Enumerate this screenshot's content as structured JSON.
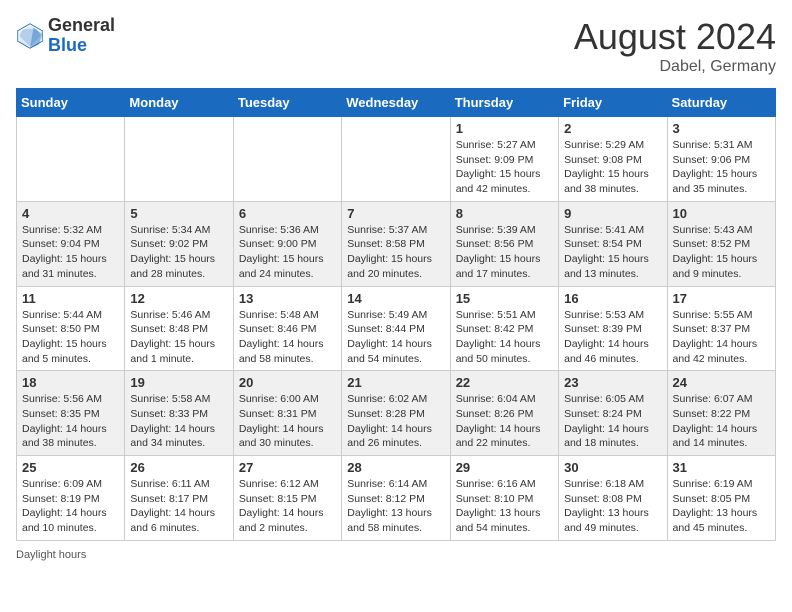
{
  "header": {
    "logo_general": "General",
    "logo_blue": "Blue",
    "month_title": "August 2024",
    "location": "Dabel, Germany"
  },
  "calendar": {
    "weekdays": [
      "Sunday",
      "Monday",
      "Tuesday",
      "Wednesday",
      "Thursday",
      "Friday",
      "Saturday"
    ],
    "weeks": [
      [
        {
          "day": "",
          "info": ""
        },
        {
          "day": "",
          "info": ""
        },
        {
          "day": "",
          "info": ""
        },
        {
          "day": "",
          "info": ""
        },
        {
          "day": "1",
          "info": "Sunrise: 5:27 AM\nSunset: 9:09 PM\nDaylight: 15 hours and 42 minutes."
        },
        {
          "day": "2",
          "info": "Sunrise: 5:29 AM\nSunset: 9:08 PM\nDaylight: 15 hours and 38 minutes."
        },
        {
          "day": "3",
          "info": "Sunrise: 5:31 AM\nSunset: 9:06 PM\nDaylight: 15 hours and 35 minutes."
        }
      ],
      [
        {
          "day": "4",
          "info": "Sunrise: 5:32 AM\nSunset: 9:04 PM\nDaylight: 15 hours and 31 minutes."
        },
        {
          "day": "5",
          "info": "Sunrise: 5:34 AM\nSunset: 9:02 PM\nDaylight: 15 hours and 28 minutes."
        },
        {
          "day": "6",
          "info": "Sunrise: 5:36 AM\nSunset: 9:00 PM\nDaylight: 15 hours and 24 minutes."
        },
        {
          "day": "7",
          "info": "Sunrise: 5:37 AM\nSunset: 8:58 PM\nDaylight: 15 hours and 20 minutes."
        },
        {
          "day": "8",
          "info": "Sunrise: 5:39 AM\nSunset: 8:56 PM\nDaylight: 15 hours and 17 minutes."
        },
        {
          "day": "9",
          "info": "Sunrise: 5:41 AM\nSunset: 8:54 PM\nDaylight: 15 hours and 13 minutes."
        },
        {
          "day": "10",
          "info": "Sunrise: 5:43 AM\nSunset: 8:52 PM\nDaylight: 15 hours and 9 minutes."
        }
      ],
      [
        {
          "day": "11",
          "info": "Sunrise: 5:44 AM\nSunset: 8:50 PM\nDaylight: 15 hours and 5 minutes."
        },
        {
          "day": "12",
          "info": "Sunrise: 5:46 AM\nSunset: 8:48 PM\nDaylight: 15 hours and 1 minute."
        },
        {
          "day": "13",
          "info": "Sunrise: 5:48 AM\nSunset: 8:46 PM\nDaylight: 14 hours and 58 minutes."
        },
        {
          "day": "14",
          "info": "Sunrise: 5:49 AM\nSunset: 8:44 PM\nDaylight: 14 hours and 54 minutes."
        },
        {
          "day": "15",
          "info": "Sunrise: 5:51 AM\nSunset: 8:42 PM\nDaylight: 14 hours and 50 minutes."
        },
        {
          "day": "16",
          "info": "Sunrise: 5:53 AM\nSunset: 8:39 PM\nDaylight: 14 hours and 46 minutes."
        },
        {
          "day": "17",
          "info": "Sunrise: 5:55 AM\nSunset: 8:37 PM\nDaylight: 14 hours and 42 minutes."
        }
      ],
      [
        {
          "day": "18",
          "info": "Sunrise: 5:56 AM\nSunset: 8:35 PM\nDaylight: 14 hours and 38 minutes."
        },
        {
          "day": "19",
          "info": "Sunrise: 5:58 AM\nSunset: 8:33 PM\nDaylight: 14 hours and 34 minutes."
        },
        {
          "day": "20",
          "info": "Sunrise: 6:00 AM\nSunset: 8:31 PM\nDaylight: 14 hours and 30 minutes."
        },
        {
          "day": "21",
          "info": "Sunrise: 6:02 AM\nSunset: 8:28 PM\nDaylight: 14 hours and 26 minutes."
        },
        {
          "day": "22",
          "info": "Sunrise: 6:04 AM\nSunset: 8:26 PM\nDaylight: 14 hours and 22 minutes."
        },
        {
          "day": "23",
          "info": "Sunrise: 6:05 AM\nSunset: 8:24 PM\nDaylight: 14 hours and 18 minutes."
        },
        {
          "day": "24",
          "info": "Sunrise: 6:07 AM\nSunset: 8:22 PM\nDaylight: 14 hours and 14 minutes."
        }
      ],
      [
        {
          "day": "25",
          "info": "Sunrise: 6:09 AM\nSunset: 8:19 PM\nDaylight: 14 hours and 10 minutes."
        },
        {
          "day": "26",
          "info": "Sunrise: 6:11 AM\nSunset: 8:17 PM\nDaylight: 14 hours and 6 minutes."
        },
        {
          "day": "27",
          "info": "Sunrise: 6:12 AM\nSunset: 8:15 PM\nDaylight: 14 hours and 2 minutes."
        },
        {
          "day": "28",
          "info": "Sunrise: 6:14 AM\nSunset: 8:12 PM\nDaylight: 13 hours and 58 minutes."
        },
        {
          "day": "29",
          "info": "Sunrise: 6:16 AM\nSunset: 8:10 PM\nDaylight: 13 hours and 54 minutes."
        },
        {
          "day": "30",
          "info": "Sunrise: 6:18 AM\nSunset: 8:08 PM\nDaylight: 13 hours and 49 minutes."
        },
        {
          "day": "31",
          "info": "Sunrise: 6:19 AM\nSunset: 8:05 PM\nDaylight: 13 hours and 45 minutes."
        }
      ]
    ]
  },
  "footer": {
    "daylight_label": "Daylight hours"
  }
}
